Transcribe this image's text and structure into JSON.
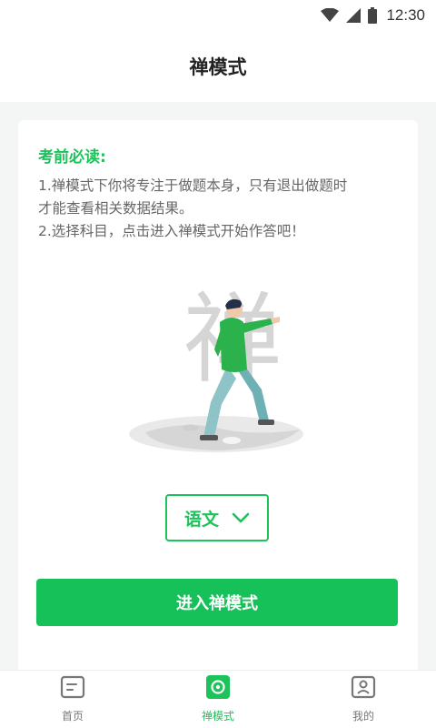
{
  "status_bar": {
    "time": "12:30",
    "icons": [
      "wifi-icon",
      "cellular-signal-icon",
      "battery-icon"
    ]
  },
  "header": {
    "title": "禅模式"
  },
  "notice": {
    "heading": "考前必读:",
    "lines": [
      "1.禅模式下你将专注于做题本身，只有退出做题时",
      "才能查看相关数据结果。",
      "2.选择科目，点击进入禅模式开始作答吧！"
    ]
  },
  "illustration": {
    "character": "禅",
    "icon": "meditation-figure-illustration"
  },
  "subject_select": {
    "selected": "语文",
    "icon": "chevron-down-icon"
  },
  "actions": {
    "enter_label": "进入禅模式"
  },
  "tabbar": {
    "items": [
      {
        "label": "首页",
        "icon": "home-icon",
        "active": false
      },
      {
        "label": "禅模式",
        "icon": "zen-mode-icon",
        "active": true
      },
      {
        "label": "我的",
        "icon": "profile-icon",
        "active": false
      }
    ]
  },
  "colors": {
    "accent": "#1cc25a",
    "button": "#17c15a",
    "text_secondary": "#666666",
    "page_background": "#f4f5f5"
  }
}
